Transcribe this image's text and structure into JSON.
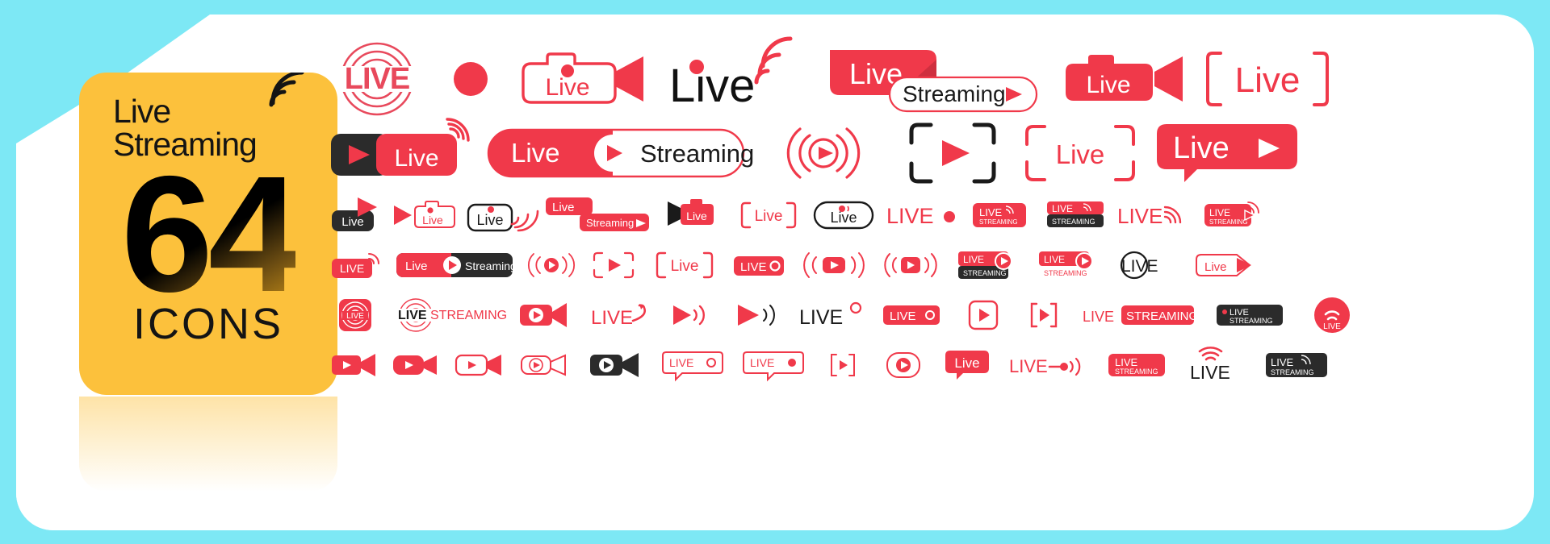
{
  "page": {
    "background_color": "#7de8f5",
    "sheet_color": "#ffffff",
    "accent_red": "#f0394a",
    "accent_red_soft": "#ef4356",
    "dark": "#2b2b2b",
    "yellow": "#fcc13c"
  },
  "cover": {
    "title_line1": "Live",
    "title_line2": "Streaming",
    "count": "64",
    "subtitle": "ICONS",
    "wifi_icon": "wifi-signal-icon"
  },
  "icon_sets": {
    "row1": [
      {
        "name": "live-ripple-badge",
        "label": "LIVE",
        "style": "outline-ripple"
      },
      {
        "name": "record-dot",
        "label": "",
        "style": "solid-dot"
      },
      {
        "name": "live-camcorder-outline",
        "label": "Live",
        "style": "camera-outline"
      },
      {
        "name": "live-wifi-black",
        "label": "Live",
        "style": "text-wifi"
      },
      {
        "name": "live-streaming-stacked",
        "label": "Live",
        "label2": "Streaming",
        "style": "stacked-ribbon"
      },
      {
        "name": "live-camcorder-solid",
        "label": "Live",
        "style": "camera-solid"
      },
      {
        "name": "live-bracket-outline",
        "label": "Live",
        "style": "bracket"
      }
    ],
    "row2": [
      {
        "name": "live-play-dark-pill",
        "label": "Live",
        "style": "dark-play-pill"
      },
      {
        "name": "live-streaming-pill",
        "label": "Live",
        "label2": "Streaming",
        "style": "split-pill"
      },
      {
        "name": "play-signal-waves",
        "label": "",
        "style": "play-waves"
      },
      {
        "name": "play-focus-frame",
        "label": "",
        "style": "focus-frame"
      },
      {
        "name": "live-corner-frame",
        "label": "Live",
        "style": "corner-frame"
      },
      {
        "name": "live-speech-bubble",
        "label": "Live",
        "style": "speech-bubble-play"
      }
    ],
    "row3": [
      {
        "name": "live-dark-tag-play",
        "label": "Live"
      },
      {
        "name": "play-live-camera-outline",
        "label": "Live"
      },
      {
        "name": "live-box-wifi",
        "label": "Live"
      },
      {
        "name": "live-streaming-offset-tags",
        "label": "Live",
        "label2": "Streaming"
      },
      {
        "name": "live-camcorder-left",
        "label": "Live"
      },
      {
        "name": "live-bracket-small",
        "label": "Live"
      },
      {
        "name": "live-pill-outline-signal",
        "label": "Live"
      },
      {
        "name": "live-dot-text",
        "label": "LIVE"
      },
      {
        "name": "live-streaming-red-tag",
        "label": "LIVE",
        "label2": "STREAMING"
      },
      {
        "name": "live-streaming-dark-tag",
        "label": "LIVE",
        "label2": "STREAMING"
      },
      {
        "name": "live-text-signal",
        "label": "LIVE"
      },
      {
        "name": "live-streaming-play-tag",
        "label": "LIVE",
        "label2": "STREAMING"
      }
    ],
    "row4": [
      {
        "name": "live-red-tag-signal",
        "label": "LIVE"
      },
      {
        "name": "live-streaming-circle-play-pill",
        "label": "Live",
        "label2": "Streaming"
      },
      {
        "name": "play-circle-waves-small",
        "label": ""
      },
      {
        "name": "play-dashed-frame",
        "label": ""
      },
      {
        "name": "live-bracket-red",
        "label": "Live"
      },
      {
        "name": "live-tag-record",
        "label": "LIVE"
      },
      {
        "name": "play-tag-waves",
        "label": ""
      },
      {
        "name": "play-tag-signal-arcs",
        "label": ""
      },
      {
        "name": "live-streaming-dark-play",
        "label": "LIVE",
        "label2": "STREAMING"
      },
      {
        "name": "live-streaming-red-play",
        "label": "LIVE",
        "label2": "STREAMING"
      },
      {
        "name": "live-circle-text",
        "label": "LIVE"
      },
      {
        "name": "live-arrow-tag",
        "label": "Live"
      }
    ],
    "row5": [
      {
        "name": "live-ripple-square-tag",
        "label": "LIVE"
      },
      {
        "name": "live-streaming-ripple-text",
        "label": "LIVE",
        "label2": "STREAMING"
      },
      {
        "name": "play-camcorder-red",
        "label": ""
      },
      {
        "name": "live-swoosh",
        "label": "LIVE"
      },
      {
        "name": "play-signal-arrow",
        "label": ""
      },
      {
        "name": "play-triangle-waves",
        "label": ""
      },
      {
        "name": "live-degree-text",
        "label": "LIVE"
      },
      {
        "name": "live-tag-circle-dot",
        "label": "LIVE"
      },
      {
        "name": "play-square-outline",
        "label": ""
      },
      {
        "name": "play-bracket-small",
        "label": ""
      },
      {
        "name": "live-streaming-two-tone",
        "label": "LIVE",
        "label2": "STREAMING"
      },
      {
        "name": "live-streaming-dark-dot",
        "label": "LIVE",
        "label2": "STREAMING"
      },
      {
        "name": "live-wifi-circle",
        "label": "LIVE"
      }
    ],
    "row6": [
      {
        "name": "play-camcorder-red-2",
        "label": ""
      },
      {
        "name": "play-camcorder-rounded",
        "label": ""
      },
      {
        "name": "play-camcorder-outline",
        "label": ""
      },
      {
        "name": "play-camcorder-outline-2",
        "label": ""
      },
      {
        "name": "play-camcorder-dark",
        "label": ""
      },
      {
        "name": "live-bubble-dot-outline",
        "label": "LIVE"
      },
      {
        "name": "live-bubble-dot-outline-2",
        "label": "LIVE"
      },
      {
        "name": "play-bracket-outline",
        "label": ""
      },
      {
        "name": "play-rounded-frame",
        "label": ""
      },
      {
        "name": "live-solid-bubble",
        "label": "Live"
      },
      {
        "name": "live-dash-waves",
        "label": "LIVE"
      },
      {
        "name": "live-streaming-red-tag-2",
        "label": "LIVE",
        "label2": "STREAMING"
      },
      {
        "name": "live-wifi-text",
        "label": "LIVE"
      },
      {
        "name": "live-streaming-dark-tag-2",
        "label": "LIVE",
        "label2": "STREAMING"
      }
    ]
  }
}
